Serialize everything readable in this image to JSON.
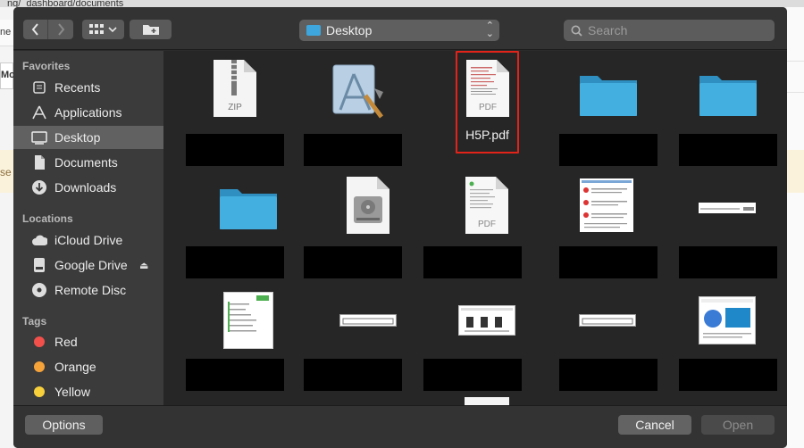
{
  "background": {
    "path_fragment": "ng/_dashboard/documents",
    "left_fragment_1": "ne",
    "left_fragment_2": "Mo",
    "left_fragment_3": "se"
  },
  "toolbar": {
    "location": "Desktop",
    "search_placeholder": "Search"
  },
  "sidebar": {
    "favorites_header": "Favorites",
    "favorites": [
      {
        "label": "Recents",
        "icon": "recents-icon"
      },
      {
        "label": "Applications",
        "icon": "applications-icon"
      },
      {
        "label": "Desktop",
        "icon": "desktop-icon"
      },
      {
        "label": "Documents",
        "icon": "documents-icon"
      },
      {
        "label": "Downloads",
        "icon": "downloads-icon"
      }
    ],
    "locations_header": "Locations",
    "locations": [
      {
        "label": "iCloud Drive",
        "icon": "cloud-icon"
      },
      {
        "label": "Google Drive",
        "icon": "drive-icon"
      },
      {
        "label": "Remote Disc",
        "icon": "disc-icon"
      }
    ],
    "tags_header": "Tags",
    "tags": [
      {
        "label": "Red",
        "color": "#f2504b"
      },
      {
        "label": "Orange",
        "color": "#f6a33a"
      },
      {
        "label": "Yellow",
        "color": "#f7d03c"
      }
    ]
  },
  "files": {
    "zip_label": "ZIP",
    "pdf_label": "PDF",
    "selected_name": "H5P.pdf"
  },
  "bottom": {
    "options": "Options",
    "cancel": "Cancel",
    "open": "Open"
  },
  "colors": {
    "highlight": "#e2231a",
    "folder": "#3ea6dc"
  }
}
